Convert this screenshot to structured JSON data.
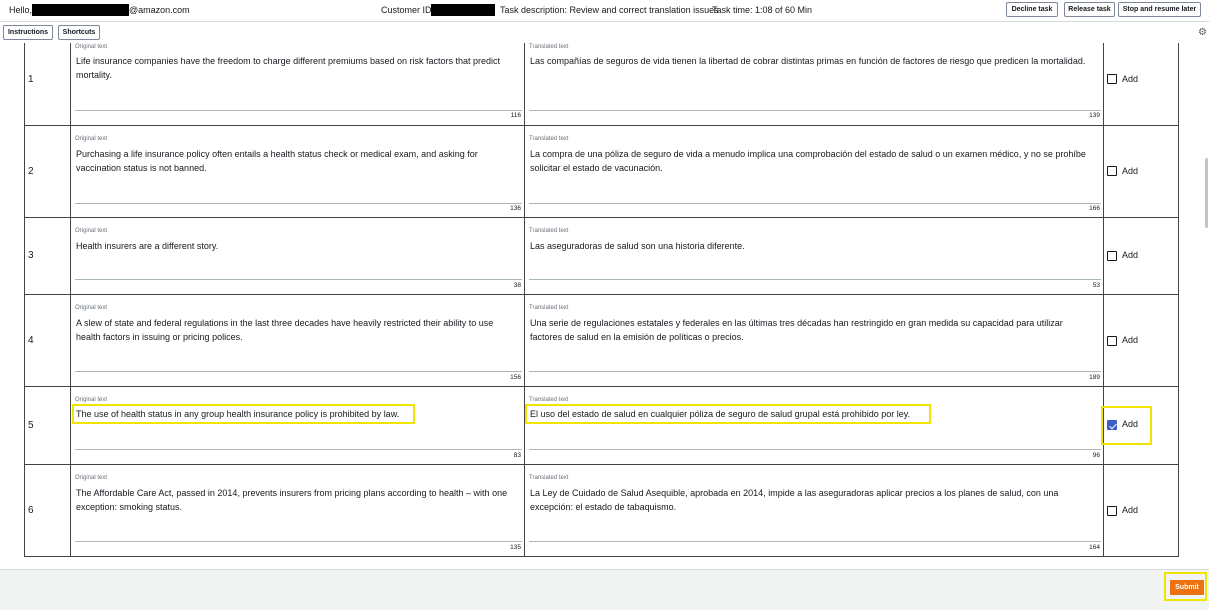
{
  "header": {
    "hello_prefix": "Hello,",
    "hello_suffix": "@amazon.com",
    "customer_id_label": "Customer ID:",
    "task_description": "Task description: Review and correct translation issues",
    "task_time": "Task time: 1:08 of 60 Min",
    "buttons": {
      "decline": "Decline task",
      "release": "Release task",
      "stop": "Stop and resume later"
    }
  },
  "toolbar": {
    "instructions": "Instructions",
    "shortcuts": "Shortcuts",
    "settings_icon": "gear-icon"
  },
  "labels": {
    "original": "Original text",
    "translated": "Translated text",
    "add": "Add"
  },
  "rows": [
    {
      "num": "1",
      "original": "Life insurance companies have the freedom to charge different premiums based on risk factors that predict mortality.",
      "original_count": "116",
      "translated": "Las compañías de seguros de vida tienen la libertad de cobrar distintas primas en función de factores de riesgo que predicen la mortalidad.",
      "translated_count": "139",
      "checked": false
    },
    {
      "num": "2",
      "original": "Purchasing a life insurance policy often entails a health status check or medical exam, and asking for vaccination status is not banned.",
      "original_count": "136",
      "translated": "La compra de una póliza de seguro de vida a menudo implica una comprobación del estado de salud o un examen médico, y no se prohíbe solicitar el estado de vacunación.",
      "translated_count": "166",
      "checked": false
    },
    {
      "num": "3",
      "original": "Health insurers are a different story.",
      "original_count": "38",
      "translated": "Las aseguradoras de salud son una historia diferente.",
      "translated_count": "53",
      "checked": false
    },
    {
      "num": "4",
      "original": "A slew of state and federal regulations in the last three decades have heavily restricted their ability to use health factors in issuing or pricing polices.",
      "original_count": "156",
      "translated": "Una serie de regulaciones estatales y federales en las últimas tres décadas han restringido en gran medida su capacidad para utilizar factores de salud en la emisión de políticas o precios.",
      "translated_count": "189",
      "checked": false
    },
    {
      "num": "5",
      "original": "The use of health status in any group health insurance policy is prohibited by law.",
      "original_count": "83",
      "translated": "El uso del estado de salud en cualquier póliza de seguro de salud grupal está prohibido por ley.",
      "translated_count": "96",
      "checked": true
    },
    {
      "num": "6",
      "original": "The Affordable Care Act, passed in 2014, prevents insurers from pricing plans according to health – with one exception: smoking status.",
      "original_count": "135",
      "translated": "La Ley de Cuidado de Salud Asequible, aprobada en 2014, impide a las aseguradoras aplicar precios a los planes de salud, con una excepción: el estado de tabaquismo.",
      "translated_count": "164",
      "checked": false
    }
  ],
  "footer": {
    "submit": "Submit"
  },
  "colors": {
    "accent": "#ec7211",
    "highlight": "#f0e500",
    "checkbox_checked": "#3b5fc4"
  }
}
